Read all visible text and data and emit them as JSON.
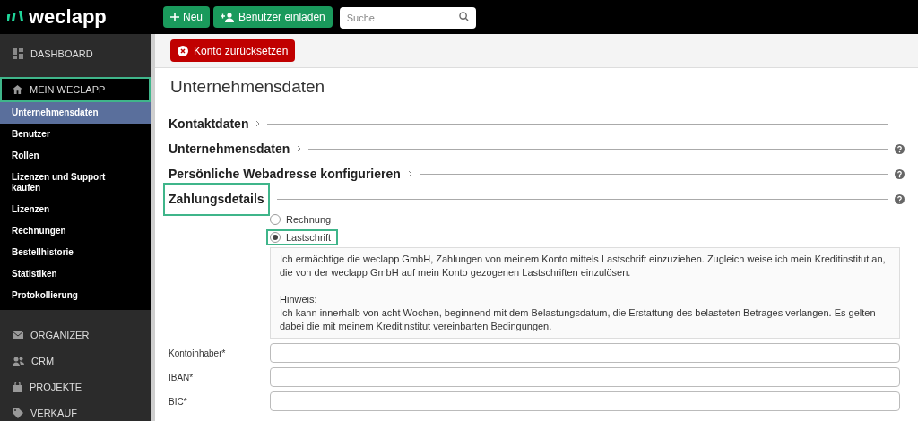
{
  "topbar": {
    "logo": "weclapp",
    "buttons": [
      {
        "kind": "new",
        "label": "Neu"
      },
      {
        "kind": "invite",
        "label": "Benutzer einladen"
      }
    ],
    "search": {
      "placeholder": "Suche"
    }
  },
  "sidebar": {
    "sections": [
      {
        "kind": "dashboard",
        "label": "DASHBOARD",
        "expanded": false,
        "highlighted": false
      },
      {
        "kind": "home",
        "label": "MEIN WECLAPP",
        "expanded": true,
        "highlighted": true,
        "items": [
          {
            "label": "Unternehmensdaten",
            "selected": true
          },
          {
            "label": "Benutzer",
            "selected": false
          },
          {
            "label": "Rollen",
            "selected": false
          },
          {
            "label": "Lizenzen und Support kaufen",
            "selected": false
          },
          {
            "label": "Lizenzen",
            "selected": false
          },
          {
            "label": "Rechnungen",
            "selected": false
          },
          {
            "label": "Bestellhistorie",
            "selected": false
          },
          {
            "label": "Statistiken",
            "selected": false
          },
          {
            "label": "Protokollierung",
            "selected": false
          }
        ]
      },
      {
        "kind": "mail",
        "label": "ORGANIZER",
        "expanded": false,
        "highlighted": false
      },
      {
        "kind": "people",
        "label": "CRM",
        "expanded": false,
        "highlighted": false
      },
      {
        "kind": "bag",
        "label": "PROJEKTE",
        "expanded": false,
        "highlighted": false
      },
      {
        "kind": "tag",
        "label": "VERKAUF",
        "expanded": false,
        "highlighted": false
      }
    ]
  },
  "toolbar": {
    "reset_button": "Konto zurücksetzen"
  },
  "page_title": "Unternehmensdaten",
  "sections": [
    {
      "title": "Kontaktdaten",
      "chevron": true,
      "help": false,
      "highlighted": false
    },
    {
      "title": "Unternehmensdaten",
      "chevron": true,
      "help": true,
      "highlighted": false
    },
    {
      "title": "Persönliche Webadresse konfigurieren",
      "chevron": true,
      "help": true,
      "highlighted": false
    },
    {
      "title": "Zahlungsdetails",
      "chevron": false,
      "help": true,
      "highlighted": true
    }
  ],
  "payment_options": [
    {
      "label": "Rechnung",
      "selected": false,
      "highlighted": false
    },
    {
      "label": "Lastschrift",
      "selected": true,
      "highlighted": true
    }
  ],
  "mandate_text": [
    "Ich ermächtige die weclapp GmbH, Zahlungen von meinem Konto mittels Lastschrift einzuziehen. Zugleich weise ich mein Kreditinstitut an, die von der weclapp GmbH auf mein Konto gezogenen Lastschriften einzulösen.",
    "Hinweis:\nIch kann innerhalb von acht Wochen, beginnend mit dem Belastungsdatum, die Erstattung des belasteten Betrages verlangen. Es gelten dabei die mit meinem Kreditinstitut vereinbarten Bedingungen."
  ],
  "fields": [
    {
      "label": "Kontoinhaber*"
    },
    {
      "label": "IBAN*"
    },
    {
      "label": "BIC*"
    }
  ]
}
